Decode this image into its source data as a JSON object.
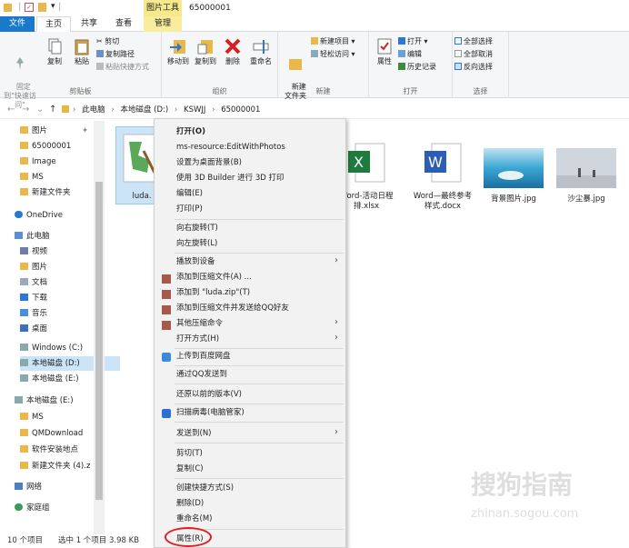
{
  "window": {
    "context_tab": "图片工具",
    "title": "65000001"
  },
  "tabs": [
    "文件",
    "主页",
    "共享",
    "查看",
    "管理"
  ],
  "ribbon": {
    "pin_label": "固定到\"快速访问\"",
    "copy": "复制",
    "paste": "粘贴",
    "cut": "剪切",
    "copy_path": "复制路径",
    "paste_shortcut": "粘贴快捷方式",
    "clipboard_group": "剪贴板",
    "move_to": "移动到",
    "copy_to": "复制到",
    "delete": "删除",
    "rename": "重命名",
    "organize_group": "组织",
    "new_folder": "新建\n文件夹",
    "new_item": "新建项目",
    "easy_access": "轻松访问",
    "new_group": "新建",
    "properties": "属性",
    "open": "打开",
    "edit": "编辑",
    "history": "历史记录",
    "open_group": "打开",
    "select_all": "全部选择",
    "select_none": "全部取消",
    "invert": "反向选择",
    "select_group": "选择"
  },
  "breadcrumb": [
    "此电脑",
    "本地磁盘 (D:)",
    "KSWJJ",
    "65000001"
  ],
  "nav": [
    "图片",
    "65000001",
    "Image",
    "MS",
    "新建文件夹",
    "OneDrive",
    "此电脑",
    "视频",
    "图片",
    "文档",
    "下载",
    "音乐",
    "桌面",
    "Windows (C:)",
    "本地磁盘 (D:)",
    "本地磁盘 (E:)",
    "本地磁盘 (E:)",
    "MS",
    "QMDownload",
    "软件安装地点",
    "新建文件夹 (4).z",
    "网络",
    "家庭组"
  ],
  "files": [
    {
      "name": "luda.",
      "kind": "image"
    },
    {
      "name": "Word-活动日程\n排.xlsx",
      "kind": "excel"
    },
    {
      "name": "Word—最终参考\n样式.docx",
      "kind": "word"
    },
    {
      "name": "背景图片.jpg",
      "kind": "photo-sea"
    },
    {
      "name": "沙尘暴.jpg",
      "kind": "photo-dust"
    }
  ],
  "status": {
    "count": "10 个项目",
    "selected": "选中 1 个项目  3.98 KB"
  },
  "menu": [
    "打开(O)",
    "ms-resource:EditWithPhotos",
    "设置为桌面背景(B)",
    "使用 3D Builder 进行 3D 打印",
    "编辑(E)",
    "打印(P)",
    "向右旋转(T)",
    "向左旋转(L)",
    "播放到设备",
    "添加到压缩文件(A) ...",
    "添加到 \"luda.zip\"(T)",
    "添加到压缩文件并发送给QQ好友",
    "其他压缩命令",
    "打开方式(H)",
    "上传到百度网盘",
    "通过QQ发送到",
    "还原以前的版本(V)",
    "扫描病毒(电脑管家)",
    "发送到(N)",
    "剪切(T)",
    "复制(C)",
    "创建快捷方式(S)",
    "删除(D)",
    "重命名(M)",
    "属性(R)"
  ],
  "watermark": {
    "line1": "搜狗指南",
    "line2": "zhinan.sogou.com"
  }
}
